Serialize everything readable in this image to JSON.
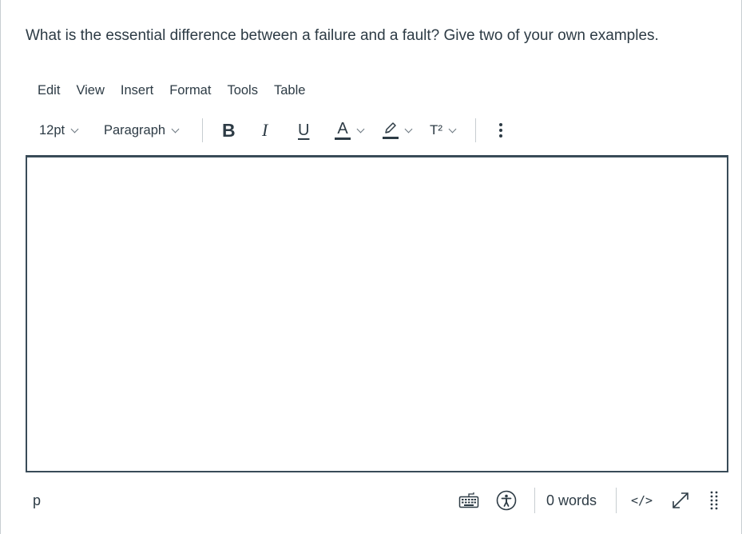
{
  "question": {
    "text": "What is the essential difference between a failure and a fault? Give two of your own examples."
  },
  "menubar": {
    "items": [
      "Edit",
      "View",
      "Insert",
      "Format",
      "Tools",
      "Table"
    ]
  },
  "toolbar": {
    "font_size": "12pt",
    "block_format": "Paragraph",
    "bold_label": "B",
    "italic_label": "I",
    "underline_label": "U",
    "text_color_label": "A",
    "superscript_label": "T²",
    "more_icon": "vertical-ellipsis-icon",
    "colors": {
      "text_color_bar": "#2d3b45",
      "highlight_bar": "#2d3b45"
    }
  },
  "editor": {
    "content": ""
  },
  "statusbar": {
    "path": "p",
    "word_count": "0 words",
    "html_editor_label": "</>",
    "icons": [
      "keyboard-icon",
      "accessibility-icon",
      "fullscreen-icon",
      "resize-grip-icon"
    ]
  },
  "colors": {
    "text": "#2d3b45",
    "border": "#394b58",
    "divider": "#c7cdd1"
  }
}
